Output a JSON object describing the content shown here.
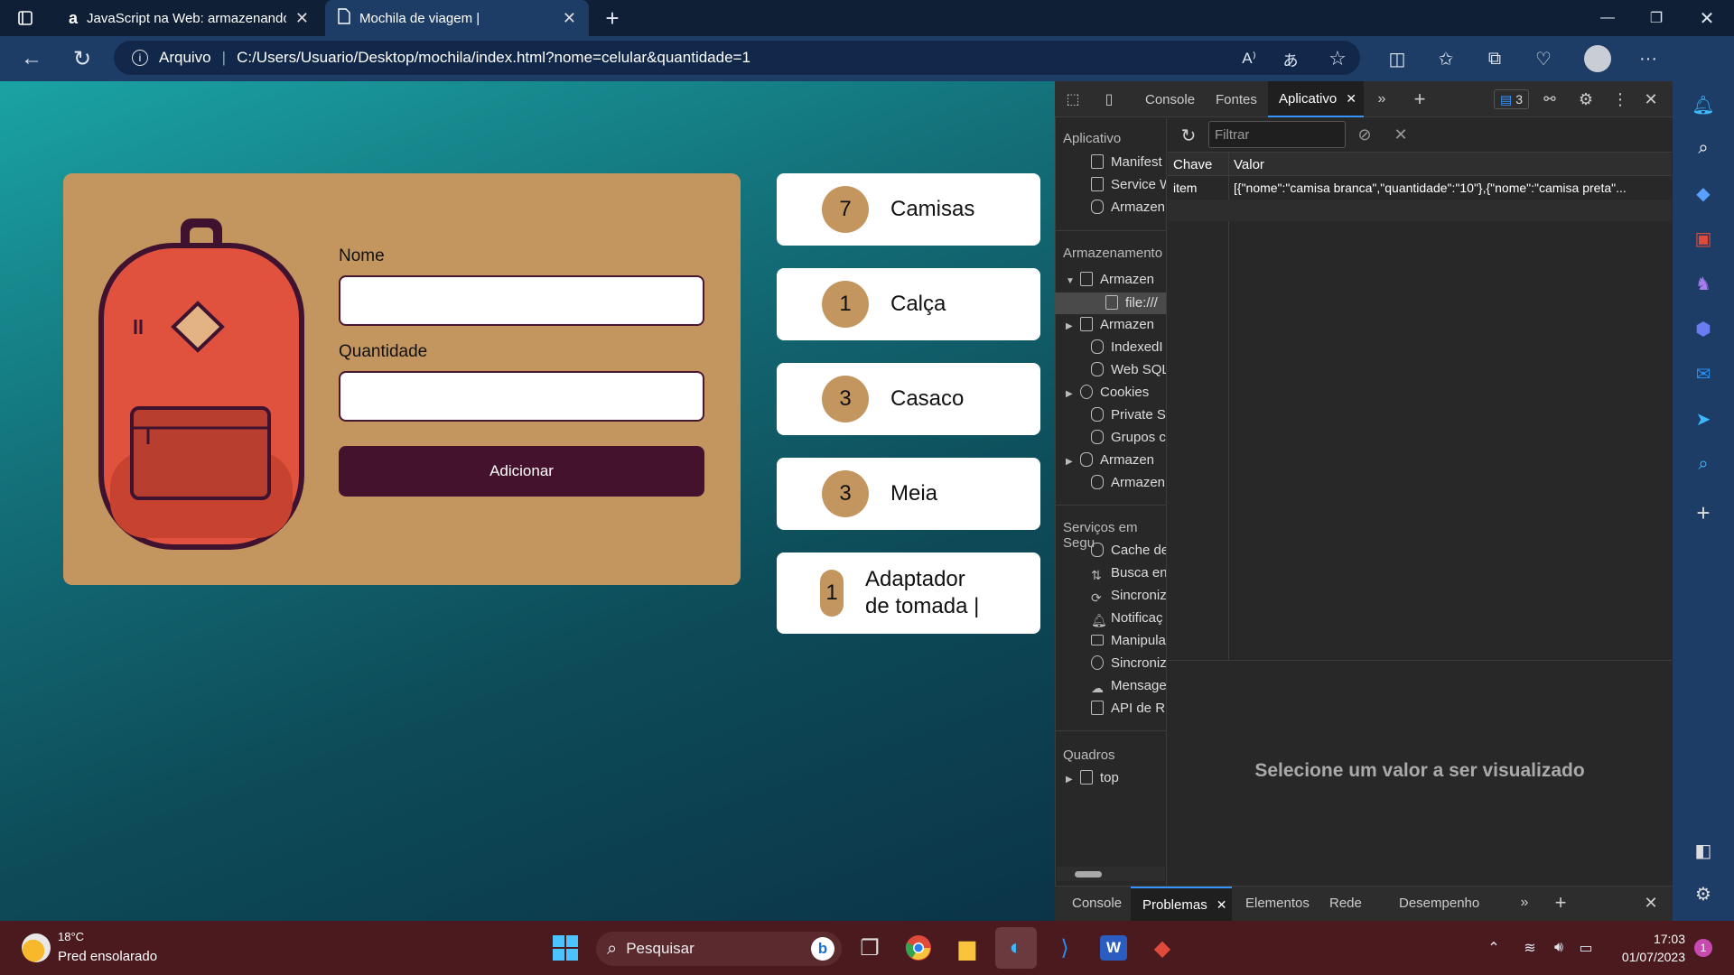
{
  "browser": {
    "tabs": [
      {
        "title": "JavaScript na Web: armazenando",
        "favicon": "a"
      },
      {
        "title": "Mochila de viagem |"
      }
    ],
    "address": {
      "security": "Arquivo",
      "url": "C:/Users/Usuario/Desktop/mochila/index.html?nome=celular&quantidade=1"
    }
  },
  "app": {
    "form": {
      "name_label": "Nome",
      "qty_label": "Quantidade",
      "add_label": "Adicionar"
    },
    "items": [
      {
        "qty": "7",
        "name": "Camisas"
      },
      {
        "qty": "1",
        "name": "Calça"
      },
      {
        "qty": "3",
        "name": "Casaco"
      },
      {
        "qty": "3",
        "name": "Meia"
      },
      {
        "qty": "1",
        "name_line1": "Adaptador",
        "name_line2": "de tomada |"
      }
    ]
  },
  "devtools": {
    "tabs": [
      "Console",
      "Fontes",
      "Aplicativo"
    ],
    "issues_count": "3",
    "filter_placeholder": "Filtrar",
    "sidebar": {
      "sec_app": "Aplicativo",
      "app_items": [
        "Manifest",
        "Service W",
        "Armazen"
      ],
      "sec_storage": "Armazenamento",
      "storage_items": [
        "Armazen",
        "file:///",
        "Armazen",
        "IndexedI",
        "Web SQL",
        "Cookies",
        "Private S",
        "Grupos c",
        "Armazen",
        "Armazen"
      ],
      "sec_services": "Serviços em Segu",
      "service_items": [
        "Cache de",
        "Busca en",
        "Sincroniz",
        "Notificaç",
        "Manipula",
        "Sincroniz",
        "Mensage",
        "API de R"
      ],
      "sec_frames": "Quadros",
      "frame_items": [
        "top"
      ]
    },
    "table": {
      "col_key": "Chave",
      "col_value": "Valor",
      "rows": [
        {
          "key": "item",
          "value": "[{\"nome\":\"camisa branca\",\"quantidade\":\"10\"},{\"nome\":\"camisa preta\"..."
        }
      ]
    },
    "preview_placeholder": "Selecione um valor a ser visualizado",
    "drawer_tabs": [
      "Console",
      "Problemas",
      "Elementos",
      "Rede",
      "Desempenho"
    ]
  },
  "taskbar": {
    "weather_temp": "18°C",
    "weather_desc": "Pred ensolarado",
    "search_label": "Pesquisar",
    "time": "17:03",
    "date": "01/07/2023",
    "notif_count": "1"
  },
  "colors": {
    "accent": "#c4965f",
    "button": "#45122d",
    "page_top": "#1aa3a3",
    "page_bottom": "#0b3448"
  }
}
